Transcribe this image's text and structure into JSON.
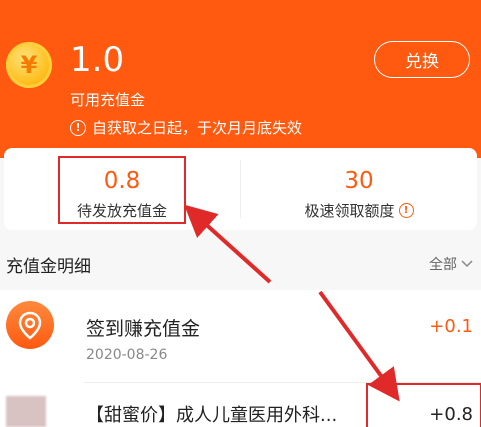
{
  "header": {
    "coin_symbol": "¥",
    "balance": "1.0",
    "balance_label": "可用充值金",
    "expire_notice": "自获取之日起，于次月月底失效",
    "exchange_button": "兑换"
  },
  "stats": [
    {
      "value": "0.8",
      "label": "待发放充值金"
    },
    {
      "value": "30",
      "label": "极速领取额度"
    }
  ],
  "section": {
    "title": "充值金明细",
    "filter_label": "全部"
  },
  "items": [
    {
      "title": "签到赚充值金",
      "date": "2020-08-26",
      "amount": "+0.1"
    },
    {
      "title": "【甜蜜价】成人儿童医用外科...",
      "amount": "+0.8"
    }
  ],
  "colors": {
    "accent": "#ff5a10",
    "annotation": "#e02a2a"
  }
}
